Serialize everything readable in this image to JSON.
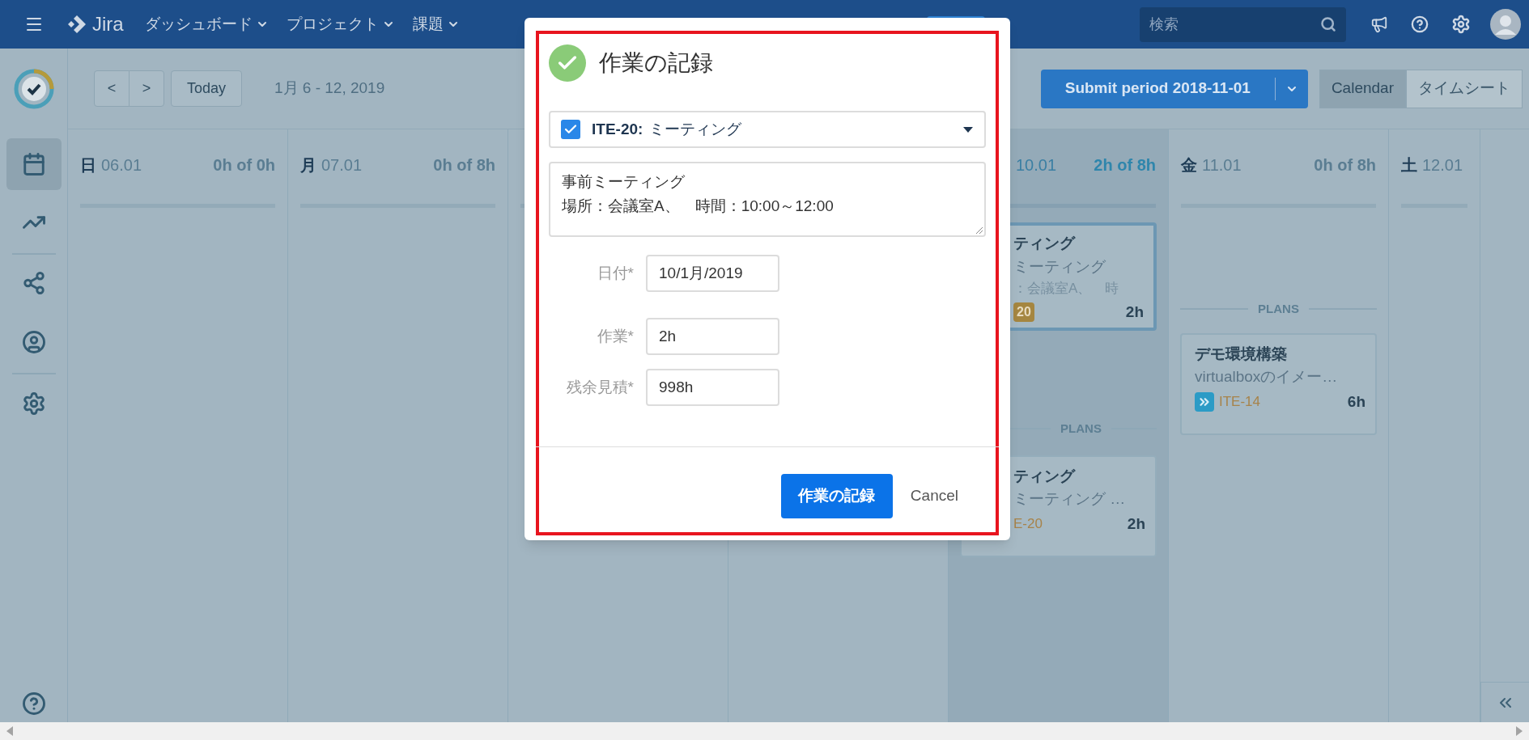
{
  "topbar": {
    "brand": "Jira",
    "menu": [
      {
        "label": "ダッシュボード"
      },
      {
        "label": "プロジェクト"
      },
      {
        "label": "課題"
      }
    ],
    "search": {
      "placeholder": "検索"
    }
  },
  "sidebar": {
    "items": [
      {
        "selected": true
      },
      {
        "selected": false
      },
      {
        "selected": false
      },
      {
        "selected": false
      },
      {
        "selected": false
      }
    ]
  },
  "toolbar": {
    "nav": [
      "<",
      ">"
    ],
    "today": "Today",
    "range": "1月 6 - 12, 2019",
    "submit": "Submit period 2018-11-01",
    "views": [
      {
        "label": "Calendar",
        "selected": true
      },
      {
        "label": "タイムシート",
        "selected": false
      }
    ]
  },
  "days": [
    {
      "weekday": "日",
      "date": "06.01",
      "hours": "0h of 0h",
      "today": false
    },
    {
      "weekday": "月",
      "date": "07.01",
      "hours": "0h of 8h",
      "today": false
    },
    {
      "today": false
    },
    {
      "today": false
    },
    {
      "date": "10.01",
      "hours": "2h of 8h",
      "today": true,
      "entries": [
        {
          "kind": "logged",
          "title": "ティング",
          "description": "ミーティング",
          "detail": "：会議室A、　時",
          "issue": "20",
          "hours": "2h"
        },
        {
          "kind": "divider",
          "label": "PLANS"
        },
        {
          "kind": "plan",
          "title": "ティング",
          "description": "ミーティング …",
          "issue": "E-20",
          "hours": "2h"
        }
      ]
    },
    {
      "weekday": "金",
      "date": "11.01",
      "hours": "0h of 8h",
      "today": false,
      "entries": [
        {
          "kind": "divider",
          "label": "PLANS"
        },
        {
          "kind": "plan",
          "icon": true,
          "title": "デモ環境構築",
          "description": "virtualboxのイメー…",
          "issue": "ITE-14",
          "hours": "6h"
        }
      ]
    },
    {
      "weekday": "土",
      "date": "12.01",
      "today": false
    }
  ],
  "modal": {
    "title": "作業の記録",
    "issue": {
      "checked": true,
      "key": "ITE-20:",
      "summary": "ミーティング"
    },
    "description": [
      "事前ミーティング",
      "場所：会議室A、　時間：10:00～12:00"
    ],
    "fields": [
      {
        "label": "日付*",
        "value": "10/1月/2019"
      },
      {
        "label": "作業*",
        "value": "2h"
      },
      {
        "label": "残余見積*",
        "value": "998h"
      }
    ],
    "primary": "作業の記録",
    "cancel": "Cancel"
  }
}
